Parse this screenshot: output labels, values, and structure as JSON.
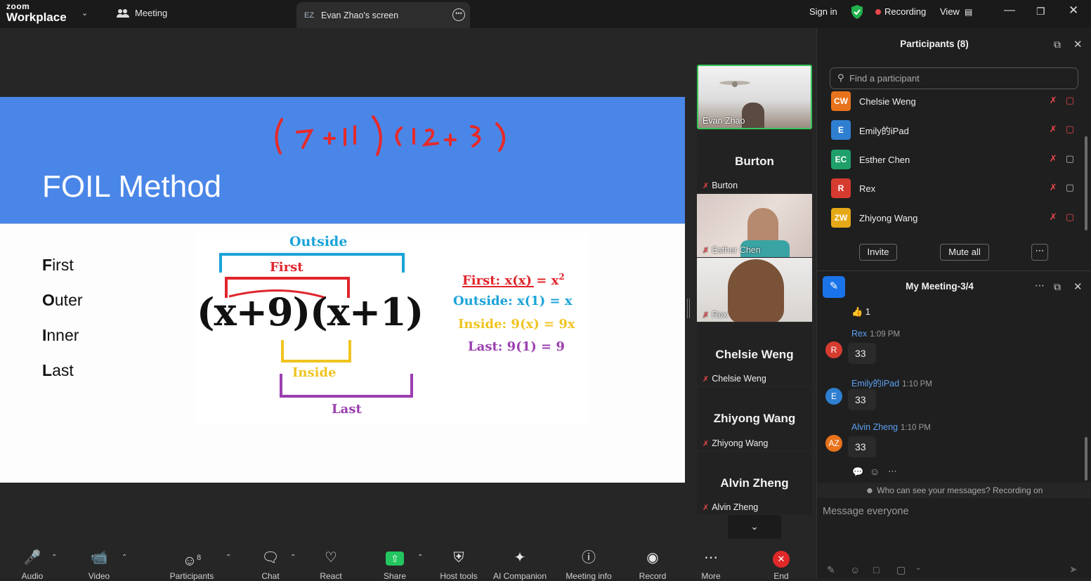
{
  "topbar": {
    "logo_top": "zoom",
    "logo_bottom": "Workplace",
    "meeting_tab": "Meeting",
    "screen_tab_badge": "EZ",
    "screen_tab": "Evan Zhao's screen",
    "sign_in": "Sign in",
    "recording": "Recording",
    "view": "View"
  },
  "slide": {
    "handwriting": "(7+11)(12+3)",
    "title": "FOIL Method",
    "list": [
      {
        "first": "F",
        "rest": "irst"
      },
      {
        "first": "O",
        "rest": "uter"
      },
      {
        "first": "I",
        "rest": "nner"
      },
      {
        "first": "L",
        "rest": "ast"
      }
    ],
    "diagram": {
      "outside": "Outside",
      "first": "First",
      "expression": "(x+9)(x+1)",
      "inside": "Inside",
      "last": "Last",
      "eq1": "First: x(x) = x",
      "eq1_exp": "2",
      "eq2": "Outside: x(1) = x",
      "eq3": "Inside: 9(x) = 9x",
      "eq4": "Last: 9(1) = 9"
    },
    "colors": {
      "blue_band": "#4a86e8",
      "outside": "#1aa3d9",
      "first": "#e0242b",
      "inside": "#f0c420",
      "last": "#9b3fb0"
    }
  },
  "video": {
    "evan": "Evan Zhao",
    "tiles": [
      {
        "big": "Burton",
        "small": "Burton"
      },
      {
        "big": "",
        "small": "Esther Chen"
      },
      {
        "big": "",
        "small": "Rex"
      },
      {
        "big": "Chelsie Weng",
        "small": "Chelsie Weng"
      },
      {
        "big": "Zhiyong Wang",
        "small": "Zhiyong Wang"
      },
      {
        "big": "Alvin Zheng",
        "small": "Alvin Zheng"
      }
    ]
  },
  "toolbar": {
    "audio": "Audio",
    "video": "Video",
    "participants": "Participants",
    "participants_count": "8",
    "chat": "Chat",
    "react": "React",
    "share": "Share",
    "host_tools": "Host tools",
    "ai_companion": "AI Companion",
    "meeting_info": "Meeting info",
    "record": "Record",
    "more": "More",
    "end": "End"
  },
  "participants": {
    "title": "Participants (8)",
    "search_placeholder": "Find a participant",
    "list": [
      {
        "initials": "CW",
        "name": "Chelsie Weng",
        "color": "#e8731c",
        "video_off": true
      },
      {
        "initials": "E",
        "name": "Emily的iPad",
        "color": "#2f7fd1",
        "video_off": true
      },
      {
        "initials": "EC",
        "name": "Esther Chen",
        "color": "#1fa06b",
        "video_off": false
      },
      {
        "initials": "R",
        "name": "Rex",
        "color": "#d63b30",
        "video_off": false
      },
      {
        "initials": "ZW",
        "name": "Zhiyong Wang",
        "color": "#e6a817",
        "video_off": true
      }
    ],
    "invite": "Invite",
    "mute_all": "Mute all"
  },
  "chat": {
    "title": "My Meeting-3/4",
    "reaction": "👍 1",
    "messages": [
      {
        "initials": "R",
        "name": "Rex",
        "time": "1:09 PM",
        "text": "33",
        "color": "#d63b30"
      },
      {
        "initials": "E",
        "name": "Emily的iPad",
        "time": "1:10 PM",
        "text": "33",
        "color": "#2f7fd1"
      },
      {
        "initials": "AZ",
        "name": "Alvin Zheng",
        "time": "1:10 PM",
        "text": "33",
        "color": "#e8731c"
      }
    ],
    "note": "Who can see your messages? Recording on",
    "placeholder": "Message everyone"
  }
}
